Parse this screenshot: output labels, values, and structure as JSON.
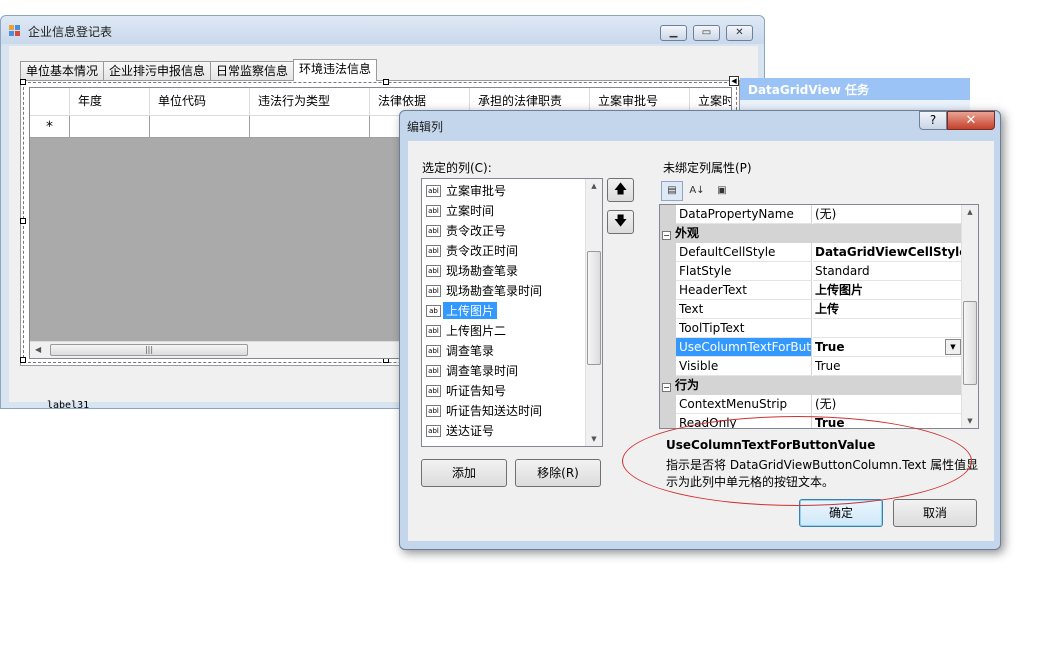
{
  "main_window": {
    "title": "企业信息登记表",
    "tabs": [
      "单位基本情况",
      "企业排污申报信息",
      "日常监察信息",
      "环境违法信息"
    ],
    "active_tab": 3,
    "grid_columns": [
      "年度",
      "单位代码",
      "违法行为类型",
      "法律依据",
      "承担的法律职责",
      "立案审批号",
      "立案时间"
    ],
    "new_row_marker": "*",
    "label": "label31"
  },
  "task_panel": {
    "title": "DataGridView 任务"
  },
  "dialog": {
    "title": "编辑列",
    "help_label": "?",
    "close_label": "✕",
    "selected_columns_label": "选定的列(C):",
    "columns": [
      "立案审批号",
      "立案时间",
      "责令改正号",
      "责令改正时间",
      "现场勘查笔录",
      "现场勘查笔录时间",
      "上传图片",
      "上传图片二",
      "调查笔录",
      "调查笔录时间",
      "听证告知号",
      "听证告知送达时间",
      "送达证号"
    ],
    "selected_index": 6,
    "column_type_icon": "abl",
    "add_label": "添加",
    "remove_label": "移除(R)",
    "props_label": "未绑定列属性(P)",
    "properties": [
      {
        "type": "prop",
        "name": "DataPropertyName",
        "value": "(无)"
      },
      {
        "type": "cat",
        "name": "外观"
      },
      {
        "type": "prop",
        "name": "DefaultCellStyle",
        "value": "DataGridViewCellStyle {",
        "bold": true
      },
      {
        "type": "prop",
        "name": "FlatStyle",
        "value": "Standard"
      },
      {
        "type": "prop",
        "name": "HeaderText",
        "value": "上传图片",
        "bold": true
      },
      {
        "type": "prop",
        "name": "Text",
        "value": "上传",
        "bold": true
      },
      {
        "type": "prop",
        "name": "ToolTipText",
        "value": ""
      },
      {
        "type": "prop",
        "name": "UseColumnTextForButt",
        "value": "True",
        "bold": true,
        "selected": true
      },
      {
        "type": "prop",
        "name": "Visible",
        "value": "True"
      },
      {
        "type": "cat",
        "name": "行为"
      },
      {
        "type": "prop",
        "name": "ContextMenuStrip",
        "value": "(无)"
      },
      {
        "type": "prop",
        "name": "ReadOnly",
        "value": "True",
        "bold": true
      }
    ],
    "description_title": "UseColumnTextForButtonValue",
    "description_text": "指示是否将 DataGridViewButtonColumn.Text 属性值显示为此列中单元格的按钮文本。",
    "ok_label": "确定",
    "cancel_label": "取消"
  },
  "colors": {
    "selection": "#3399ff",
    "annotation_ellipse": "#d03030",
    "task_panel": "#9bc3f5"
  }
}
